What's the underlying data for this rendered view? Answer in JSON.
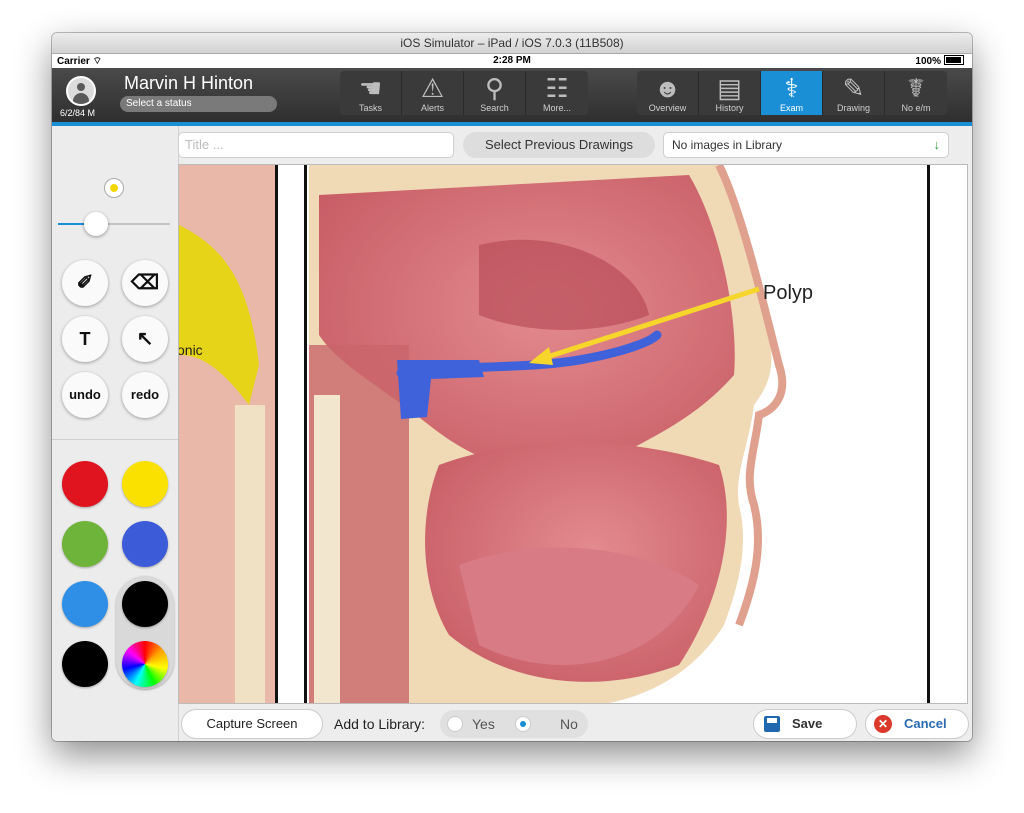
{
  "window": {
    "title": "iOS Simulator – iPad / iOS 7.0.3 (11B508)"
  },
  "status_bar": {
    "carrier": "Carrier",
    "time": "2:28 PM",
    "battery": "100%"
  },
  "patient": {
    "name": "Marvin H Hinton",
    "dob": "6/2/84 M",
    "status_placeholder": "Select a status"
  },
  "nav_left": [
    {
      "label": "Tasks",
      "icon": "hand-icon"
    },
    {
      "label": "Alerts",
      "icon": "alert-icon"
    },
    {
      "label": "Search",
      "icon": "search-icon"
    },
    {
      "label": "More...",
      "icon": "hierarchy-icon"
    }
  ],
  "nav_right": [
    {
      "label": "Overview",
      "icon": "head-icon"
    },
    {
      "label": "History",
      "icon": "history-icon"
    },
    {
      "label": "Exam",
      "icon": "stethoscope-icon",
      "active": true
    },
    {
      "label": "Drawing",
      "icon": "palette-icon"
    },
    {
      "label": "No e/m",
      "icon": "caduceus-icon"
    }
  ],
  "toolbar": {
    "title_placeholder": "Title ...",
    "prev_drawings_label": "Select Previous Drawings",
    "library_select_value": "No images in Library"
  },
  "tools": {
    "undo_label": "undo",
    "redo_label": "redo",
    "text_label": "T",
    "brush_color": "#f1d600",
    "brush_size": 0.34
  },
  "palette": {
    "colors": [
      "#e0141e",
      "#fbe100",
      "#6fb43a",
      "#3c5bd8",
      "#2f8fe6",
      "#000000",
      "#000000"
    ],
    "selected_index": 5
  },
  "drawing": {
    "annotation_label": "Polyp",
    "partial_text": "onic",
    "arrow_color": "#f6d62b",
    "stroke_color": "#3f62db"
  },
  "bottom_bar": {
    "capture_label": "Capture Screen",
    "add_to_library_label": "Add to Library:",
    "yes_label": "Yes",
    "no_label": "No",
    "add_to_library_value": "No",
    "save_label": "Save",
    "cancel_label": "Cancel"
  }
}
